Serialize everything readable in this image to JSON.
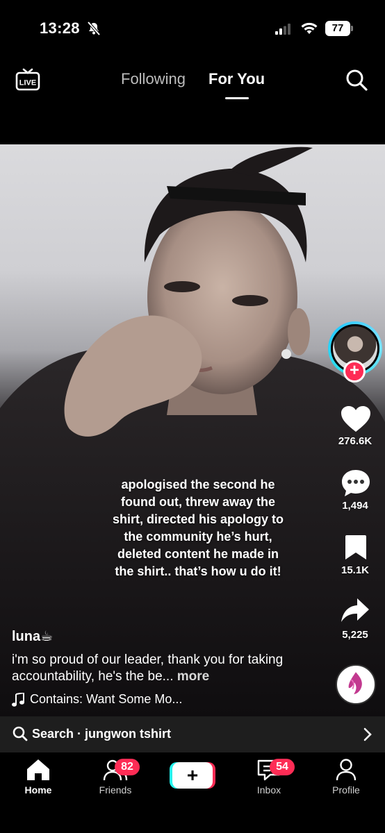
{
  "status_bar": {
    "time": "13:28",
    "battery": "77",
    "icons": [
      "bell-off-icon",
      "signal-icon",
      "wifi-icon",
      "battery-icon"
    ]
  },
  "top_nav": {
    "live_label": "LIVE",
    "tabs": [
      {
        "label": "Following",
        "active": false
      },
      {
        "label": "For You",
        "active": true
      }
    ]
  },
  "video": {
    "caption_lines": [
      "apologised the second he",
      "found out, threw away the",
      "directed his apology to",
      "the community he’s hurt,",
      "deleted content he made in",
      "the shirt.. that’s how u do it!"
    ],
    "caption_line2_fix": "shirt,"
  },
  "right_rail": {
    "likes": "276.6K",
    "comments": "1,494",
    "saves": "15.1K",
    "shares": "5,225"
  },
  "post": {
    "username": "luna☕",
    "description": "i'm so proud of our leader, thank you for taking accountability, he's the be...",
    "more_label": "more",
    "music": "Contains: Want Some Mo..."
  },
  "search_bar": {
    "text": "Search · jungwon tshirt"
  },
  "bottom_nav": {
    "items": [
      {
        "label": "Home",
        "active": true
      },
      {
        "label": "Friends",
        "badge": "82"
      },
      {
        "label": "Inbox",
        "badge": "54"
      },
      {
        "label": "Profile"
      }
    ]
  },
  "colors": {
    "accent_red": "#fe2c55",
    "accent_cyan": "#25f4ee"
  }
}
